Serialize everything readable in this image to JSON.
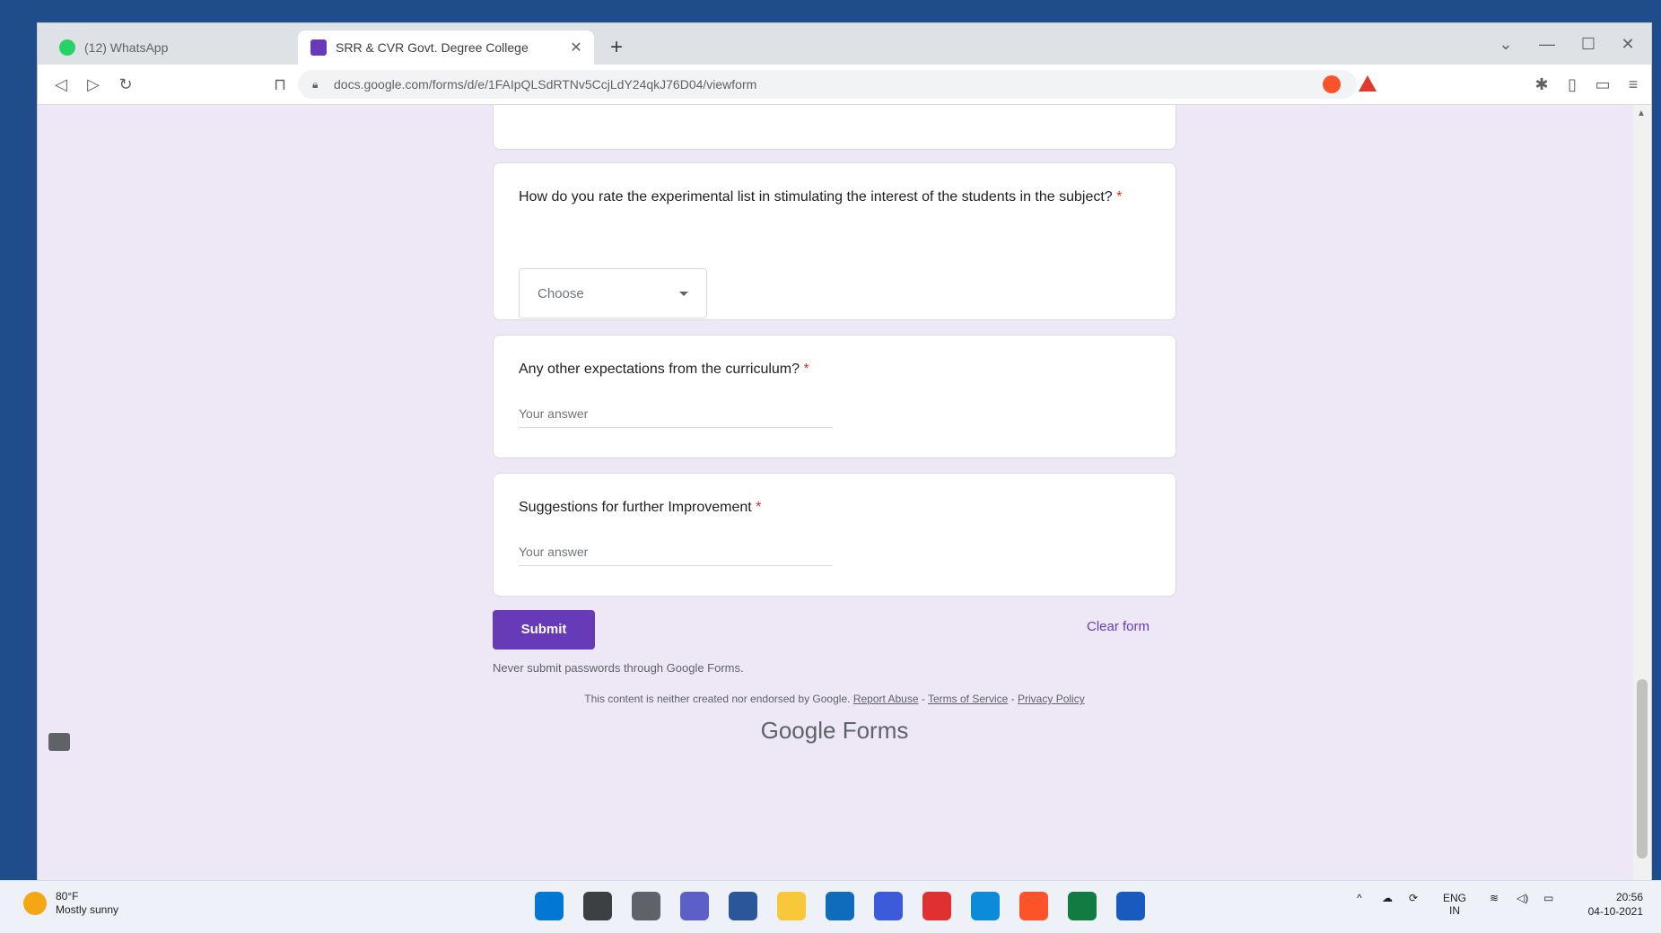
{
  "browser": {
    "tabs": [
      {
        "title": "(12) WhatsApp",
        "active": false
      },
      {
        "title": "SRR & CVR Govt. Degree College",
        "active": true
      }
    ],
    "url": "docs.google.com/forms/d/e/1FAIpQLSdRTNv5CcjLdY24qkJ76D04/viewform"
  },
  "form": {
    "questions": [
      {
        "text": "How do you rate the experimental list in stimulating the interest of the students in the subject?",
        "required_mark": "*",
        "control": "dropdown",
        "placeholder": "Choose"
      },
      {
        "text": "Any other expectations from the curriculum?",
        "required_mark": "*",
        "control": "text",
        "placeholder": "Your answer"
      },
      {
        "text": "Suggestions for further Improvement",
        "required_mark": "*",
        "control": "text",
        "placeholder": "Your answer"
      }
    ],
    "submit_label": "Submit",
    "clear_label": "Clear form",
    "password_warning": "Never submit passwords through Google Forms.",
    "footer_text": "This content is neither created nor endorsed by Google.",
    "footer_links": [
      "Report Abuse",
      "Terms of Service",
      "Privacy Policy"
    ],
    "brand_google": "Google",
    "brand_forms": "Forms"
  },
  "taskbar": {
    "weather_temp": "80°F",
    "weather_desc": "Mostly sunny",
    "lang": "ENG",
    "region": "IN",
    "time": "20:56",
    "date": "04-10-2021"
  },
  "colors": {
    "accent": "#673ab7",
    "page_bg": "#ede7f6",
    "required": "#d93025"
  }
}
